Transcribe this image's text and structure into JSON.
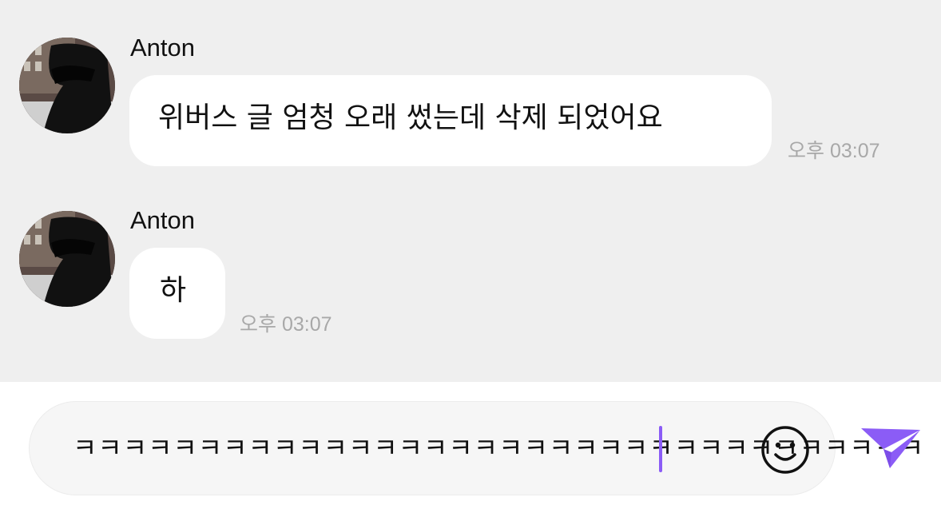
{
  "messages": [
    {
      "sender": "Anton",
      "text": "위버스 글 엄청 오래 썼는데 삭제 되었어요",
      "time": "오후 03:07"
    },
    {
      "sender": "Anton",
      "text": "하",
      "time": "오후 03:07"
    }
  ],
  "composer": {
    "input_value": "ㅋㅋㅋㅋㅋㅋㅋㅋㅋㅋㅋㅋㅋㅋㅋㅋㅋㅋㅋㅋㅋㅋㅋㅋㅋㅋㅋㅋㅋㅋㅋㅋㅋㅋ",
    "emoji_icon": "smiley-icon",
    "send_icon": "paper-plane-icon",
    "accent_color": "#8b5cf6"
  },
  "colors": {
    "chat_background": "#efefef",
    "bubble": "#ffffff",
    "timestamp": "#a8a8a8"
  }
}
